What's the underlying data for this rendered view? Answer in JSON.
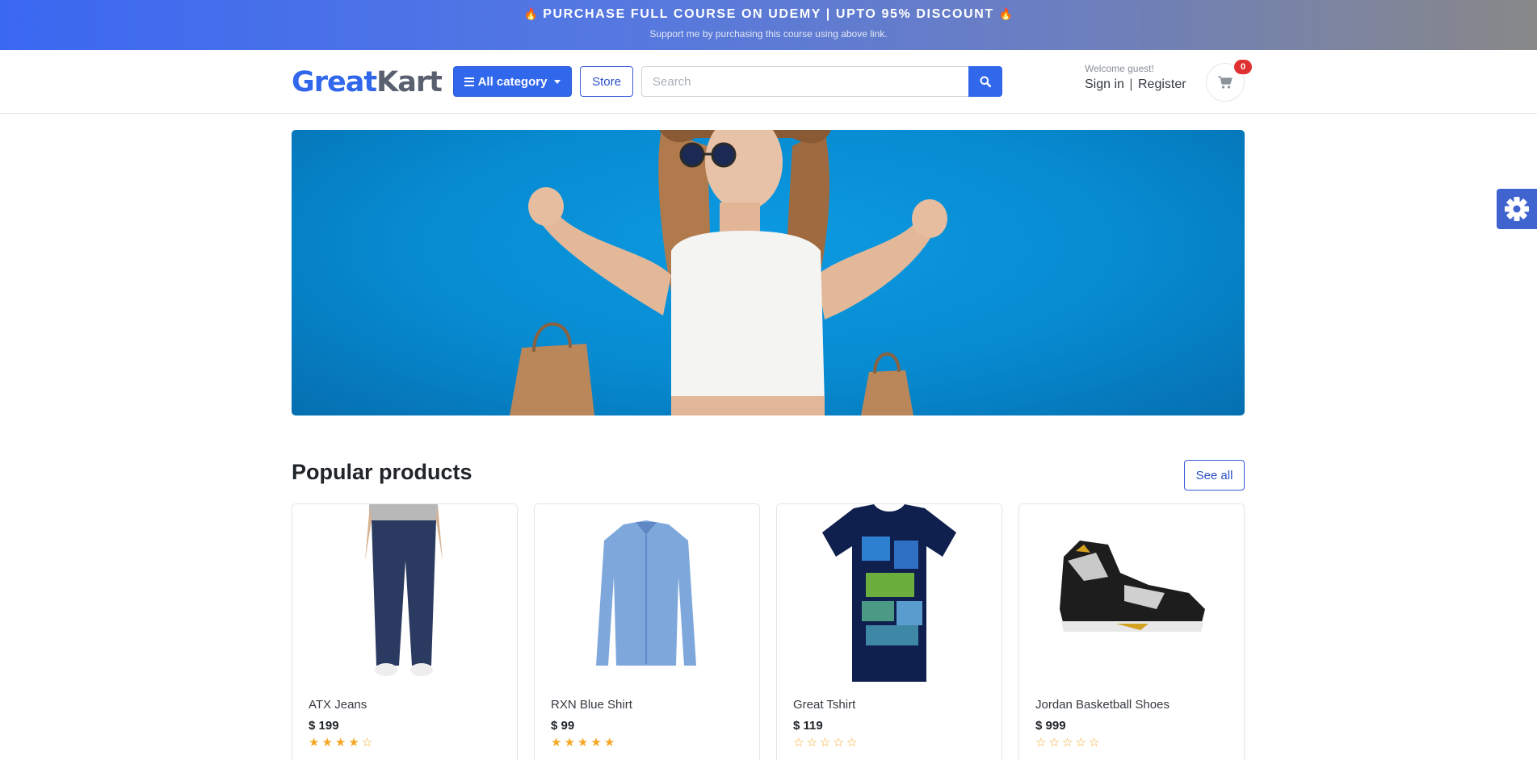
{
  "promo": {
    "flame_left": "🔥",
    "title": "PURCHASE FULL COURSE ON UDEMY | UPTO 95% DISCOUNT",
    "flame_right": "🔥",
    "subtitle": "Support me by purchasing this course using above link."
  },
  "header": {
    "logo_part1": "Great",
    "logo_part2": "Kart",
    "category_button": "All category",
    "store_button": "Store",
    "search_placeholder": "Search",
    "welcome_text": "Welcome guest!",
    "sign_in": "Sign in",
    "separator": "|",
    "register": "Register",
    "cart_count": "0"
  },
  "section": {
    "title": "Popular products",
    "see_all": "See all"
  },
  "products": [
    {
      "name": "ATX Jeans",
      "price": "$ 199",
      "rating": 4
    },
    {
      "name": "RXN Blue Shirt",
      "price": "$ 99",
      "rating": 5
    },
    {
      "name": "Great Tshirt",
      "price": "$ 119",
      "rating": 0
    },
    {
      "name": "Jordan Basketball Shoes",
      "price": "$ 999",
      "rating": 0
    }
  ],
  "colors": {
    "primary": "#3167eb",
    "star": "#f5a623",
    "badge": "#e03131"
  }
}
